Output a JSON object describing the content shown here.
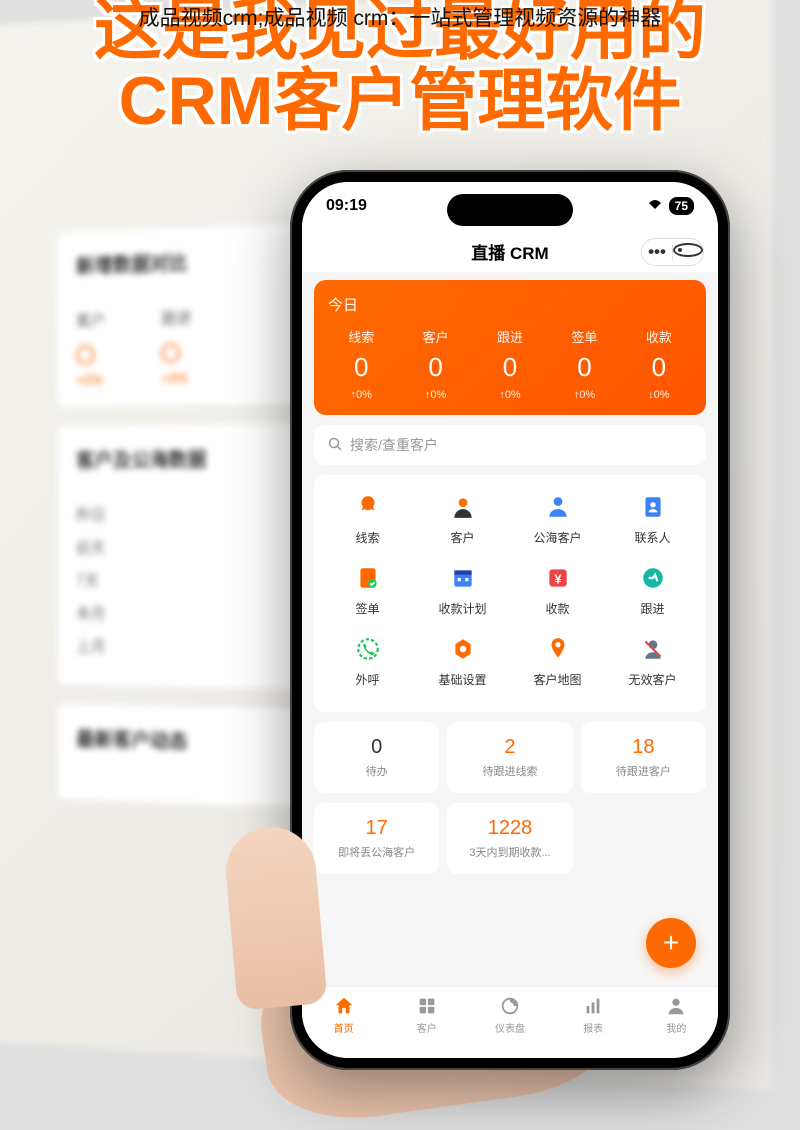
{
  "caption": "成品视频crm;成品视频 crm：一站式管理视频资源的神器",
  "headline_line1": "这是我见过最好用的",
  "headline_line2": "CRM客户管理软件",
  "bg": {
    "section1_title": "新增数据对比",
    "col1": "客户",
    "col2": "跟进",
    "val1": "+0%",
    "val2": "+0%",
    "section2_title": "客户及公海数据",
    "rows": [
      "昨日",
      "前天",
      "7天",
      "本月",
      "上月"
    ],
    "section3_title": "最新客户动态"
  },
  "status": {
    "time": "09:19",
    "battery": "75"
  },
  "app_title": "直播 CRM",
  "stats": {
    "today": "今日",
    "items": [
      {
        "label": "线索",
        "value": "0",
        "change": "↑0%"
      },
      {
        "label": "客户",
        "value": "0",
        "change": "↑0%"
      },
      {
        "label": "跟进",
        "value": "0",
        "change": "↑0%"
      },
      {
        "label": "签单",
        "value": "0",
        "change": "↑0%"
      },
      {
        "label": "收款",
        "value": "0",
        "change": "↓0%"
      }
    ]
  },
  "search_placeholder": "搜索/查重客户",
  "grid": [
    {
      "label": "线索",
      "icon": "leads-icon",
      "color": "#ff6a00"
    },
    {
      "label": "客户",
      "icon": "customer-icon",
      "color": "#ff6a00"
    },
    {
      "label": "公海客户",
      "icon": "pool-icon",
      "color": "#3b82f6"
    },
    {
      "label": "联系人",
      "icon": "contact-icon",
      "color": "#3b82f6"
    },
    {
      "label": "签单",
      "icon": "contract-icon",
      "color": "#ff6a00"
    },
    {
      "label": "收款计划",
      "icon": "plan-icon",
      "color": "#3b82f6"
    },
    {
      "label": "收款",
      "icon": "payment-icon",
      "color": "#ef4444"
    },
    {
      "label": "跟进",
      "icon": "followup-icon",
      "color": "#14b8a6"
    },
    {
      "label": "外呼",
      "icon": "call-icon",
      "color": "#22c55e"
    },
    {
      "label": "基础设置",
      "icon": "settings-icon",
      "color": "#ff6a00"
    },
    {
      "label": "客户地图",
      "icon": "map-icon",
      "color": "#ff6a00"
    },
    {
      "label": "无效客户",
      "icon": "invalid-icon",
      "color": "#64748b"
    }
  ],
  "todos": [
    {
      "num": "0",
      "label": "待办",
      "orange": false
    },
    {
      "num": "2",
      "label": "待跟进线索",
      "orange": true
    },
    {
      "num": "18",
      "label": "待跟进客户",
      "orange": true
    },
    {
      "num": "17",
      "label": "即将丢公海客户",
      "orange": true
    },
    {
      "num": "1228",
      "label": "3天内到期收款...",
      "orange": true
    }
  ],
  "tabs": [
    {
      "label": "首页",
      "icon": "home-icon",
      "active": true
    },
    {
      "label": "客户",
      "icon": "customers-tab-icon",
      "active": false
    },
    {
      "label": "仪表盘",
      "icon": "dashboard-icon",
      "active": false
    },
    {
      "label": "报表",
      "icon": "report-icon",
      "active": false
    },
    {
      "label": "我的",
      "icon": "profile-icon",
      "active": false
    }
  ]
}
